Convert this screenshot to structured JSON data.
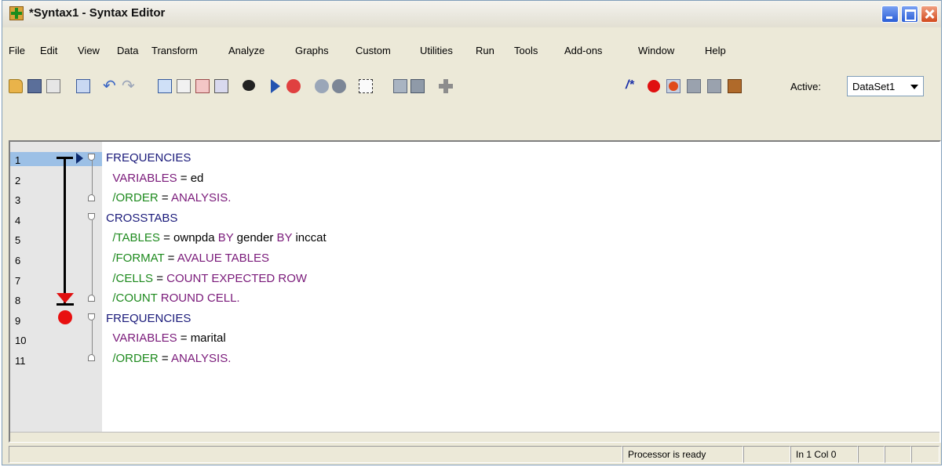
{
  "window": {
    "title": "*Syntax1 - Syntax Editor"
  },
  "menu": [
    "File",
    "Edit",
    "View",
    "Data",
    "Transform",
    "Analyze",
    "Graphs",
    "Custom",
    "Utilities",
    "Run",
    "Tools",
    "Add-ons",
    "Window",
    "Help"
  ],
  "toolbar": {
    "active_label": "Active:",
    "dataset_value": "DataSet1",
    "comment_icon_text": "/*"
  },
  "editor": {
    "line_numbers": [
      "1",
      "2",
      "3",
      "4",
      "5",
      "6",
      "7",
      "8",
      "9",
      "10",
      "11"
    ],
    "lines": [
      [
        {
          "t": "FREQUENCIES",
          "c": "kw"
        }
      ],
      [
        {
          "t": "  VARIABLES",
          "c": "kwp"
        },
        {
          "t": " = ed",
          "c": ""
        }
      ],
      [
        {
          "t": "  /ORDER",
          "c": "sub"
        },
        {
          "t": " = ",
          "c": ""
        },
        {
          "t": "ANALYSIS.",
          "c": "kwp"
        }
      ],
      [
        {
          "t": "CROSSTABS",
          "c": "kw"
        }
      ],
      [
        {
          "t": "  /TABLES",
          "c": "sub"
        },
        {
          "t": " = ownpda ",
          "c": ""
        },
        {
          "t": "BY",
          "c": "kwp"
        },
        {
          "t": " gender ",
          "c": ""
        },
        {
          "t": "BY",
          "c": "kwp"
        },
        {
          "t": " inccat",
          "c": ""
        }
      ],
      [
        {
          "t": "  /FORMAT",
          "c": "sub"
        },
        {
          "t": " = ",
          "c": ""
        },
        {
          "t": "AVALUE TABLES",
          "c": "kwp"
        }
      ],
      [
        {
          "t": "  /CELLS",
          "c": "sub"
        },
        {
          "t": " = ",
          "c": ""
        },
        {
          "t": "COUNT EXPECTED ROW",
          "c": "kwp"
        }
      ],
      [
        {
          "t": "  /COUNT",
          "c": "sub"
        },
        {
          "t": " ",
          "c": ""
        },
        {
          "t": "ROUND CELL.",
          "c": "kwp"
        }
      ],
      [
        {
          "t": "FREQUENCIES",
          "c": "kw"
        }
      ],
      [
        {
          "t": "  VARIABLES",
          "c": "kwp"
        },
        {
          "t": " = marital",
          "c": ""
        }
      ],
      [
        {
          "t": "  /ORDER",
          "c": "sub"
        },
        {
          "t": " = ",
          "c": ""
        },
        {
          "t": "ANALYSIS.",
          "c": "kwp"
        }
      ]
    ]
  },
  "status": {
    "processor": "Processor is ready",
    "position": "In 1 Col 0"
  }
}
